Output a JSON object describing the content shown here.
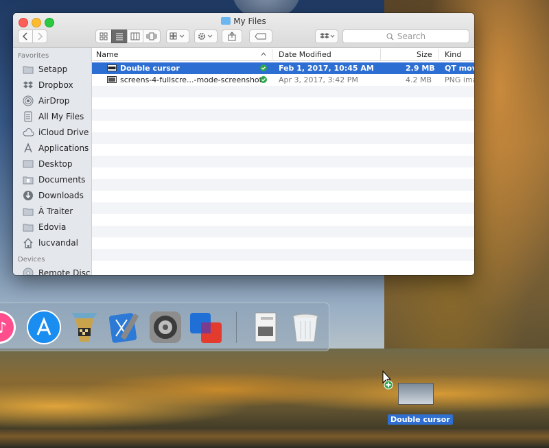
{
  "window": {
    "title": "My Files",
    "search_placeholder": "Search"
  },
  "sidebar": {
    "favorites_heading": "Favorites",
    "devices_heading": "Devices",
    "items": [
      {
        "label": "Setapp",
        "icon": "folder-icon"
      },
      {
        "label": "Dropbox",
        "icon": "dropbox-icon"
      },
      {
        "label": "AirDrop",
        "icon": "airdrop-icon"
      },
      {
        "label": "All My Files",
        "icon": "all-files-icon"
      },
      {
        "label": "iCloud Drive",
        "icon": "cloud-icon"
      },
      {
        "label": "Applications",
        "icon": "applications-icon"
      },
      {
        "label": "Desktop",
        "icon": "desktop-icon"
      },
      {
        "label": "Documents",
        "icon": "documents-icon"
      },
      {
        "label": "Downloads",
        "icon": "downloads-icon"
      },
      {
        "label": "À Traiter",
        "icon": "folder-icon"
      },
      {
        "label": "Edovia",
        "icon": "folder-icon"
      },
      {
        "label": "lucvandal",
        "icon": "home-icon"
      }
    ],
    "devices": [
      {
        "label": "Remote Disc",
        "icon": "disc-icon"
      }
    ]
  },
  "list": {
    "columns": {
      "name": "Name",
      "date": "Date Modified",
      "size": "Size",
      "kind": "Kind"
    },
    "rows": [
      {
        "name": "Double cursor",
        "date": "Feb 1, 2017, 10:45 AM",
        "size": "2.9 MB",
        "kind": "QT movie",
        "selected": true
      },
      {
        "name": "screens-4-fullscre...-mode-screenshot",
        "date": "Apr 3, 2017, 3:42 PM",
        "size": "4.2 MB",
        "kind": "PNG image",
        "selected": false
      }
    ]
  },
  "drag": {
    "label": "Double cursor"
  },
  "colors": {
    "selection": "#2d6ed2",
    "synced_badge": "#2fa84b"
  }
}
